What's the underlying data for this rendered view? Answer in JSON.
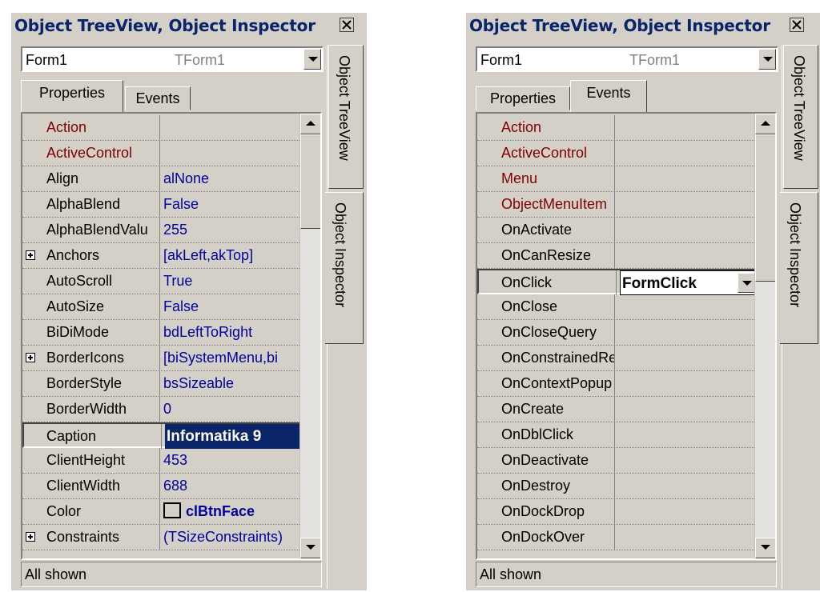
{
  "left": {
    "title": "Object TreeView, Object Inspector",
    "object_name": "Form1",
    "object_class": "TForm1",
    "tabs": [
      "Properties",
      "Events"
    ],
    "side_tabs": [
      "Object TreeView",
      "Object Inspector"
    ],
    "status": "All shown",
    "rows": [
      {
        "name": "Action",
        "value": ""
      },
      {
        "name": "ActiveControl",
        "value": ""
      },
      {
        "name": "Align",
        "value": "alNone"
      },
      {
        "name": "AlphaBlend",
        "value": "False"
      },
      {
        "name": "AlphaBlendValu",
        "value": "255"
      },
      {
        "name": "Anchors",
        "value": "[akLeft,akTop]"
      },
      {
        "name": "AutoScroll",
        "value": "True"
      },
      {
        "name": "AutoSize",
        "value": "False"
      },
      {
        "name": "BiDiMode",
        "value": "bdLeftToRight"
      },
      {
        "name": "BorderIcons",
        "value": "[biSystemMenu,bi"
      },
      {
        "name": "BorderStyle",
        "value": "bsSizeable"
      },
      {
        "name": "BorderWidth",
        "value": "0"
      },
      {
        "name": "Caption",
        "value": "Informatika 9"
      },
      {
        "name": "ClientHeight",
        "value": "453"
      },
      {
        "name": "ClientWidth",
        "value": "688"
      },
      {
        "name": "Color",
        "value": "clBtnFace"
      },
      {
        "name": "Constraints",
        "value": "(TSizeConstraints)"
      }
    ]
  },
  "right": {
    "title": "Object TreeView, Object Inspector",
    "object_name": "Form1",
    "object_class": "TForm1",
    "tabs": [
      "Properties",
      "Events"
    ],
    "side_tabs": [
      "Object TreeView",
      "Object Inspector"
    ],
    "status": "All shown",
    "rows": [
      {
        "name": "Action",
        "value": ""
      },
      {
        "name": "ActiveControl",
        "value": ""
      },
      {
        "name": "Menu",
        "value": ""
      },
      {
        "name": "ObjectMenuItem",
        "value": ""
      },
      {
        "name": "OnActivate",
        "value": ""
      },
      {
        "name": "OnCanResize",
        "value": ""
      },
      {
        "name": "OnClick",
        "value": "FormClick"
      },
      {
        "name": "OnClose",
        "value": ""
      },
      {
        "name": "OnCloseQuery",
        "value": ""
      },
      {
        "name": "OnConstrainedResize",
        "value": ""
      },
      {
        "name": "OnContextPopup",
        "value": ""
      },
      {
        "name": "OnCreate",
        "value": ""
      },
      {
        "name": "OnDblClick",
        "value": ""
      },
      {
        "name": "OnDeactivate",
        "value": ""
      },
      {
        "name": "OnDestroy",
        "value": ""
      },
      {
        "name": "OnDockDrop",
        "value": ""
      },
      {
        "name": "OnDockOver",
        "value": ""
      }
    ]
  },
  "colors": {
    "title_text": "#0a246a",
    "reference_prop": "#800000",
    "value_text": "#0000a0",
    "selection": "#0a246a"
  }
}
